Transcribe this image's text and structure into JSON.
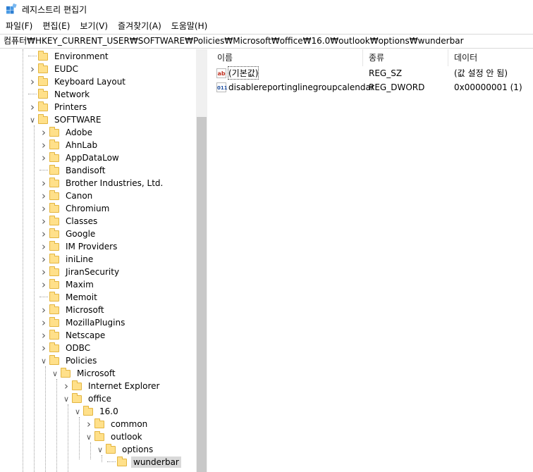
{
  "window": {
    "title": "레지스트리 편집기",
    "icon": "registry-editor-icon"
  },
  "menu": [
    "파일(F)",
    "편집(E)",
    "보기(V)",
    "즐겨찾기(A)",
    "도움말(H)"
  ],
  "address": "컴퓨터₩HKEY_CURRENT_USER₩SOFTWARE₩Policies₩Microsoft₩office₩16.0₩outlook₩options₩wunderbar",
  "tree": [
    {
      "label": "Environment",
      "level": 0,
      "expander": "none"
    },
    {
      "label": "EUDC",
      "level": 0,
      "expander": "collapsed"
    },
    {
      "label": "Keyboard Layout",
      "level": 0,
      "expander": "collapsed"
    },
    {
      "label": "Network",
      "level": 0,
      "expander": "none"
    },
    {
      "label": "Printers",
      "level": 0,
      "expander": "collapsed"
    },
    {
      "label": "SOFTWARE",
      "level": 0,
      "expander": "expanded"
    },
    {
      "label": "Adobe",
      "level": 1,
      "expander": "collapsed"
    },
    {
      "label": "AhnLab",
      "level": 1,
      "expander": "collapsed"
    },
    {
      "label": "AppDataLow",
      "level": 1,
      "expander": "collapsed"
    },
    {
      "label": "Bandisoft",
      "level": 1,
      "expander": "none"
    },
    {
      "label": "Brother Industries, Ltd.",
      "level": 1,
      "expander": "collapsed"
    },
    {
      "label": "Canon",
      "level": 1,
      "expander": "collapsed"
    },
    {
      "label": "Chromium",
      "level": 1,
      "expander": "collapsed"
    },
    {
      "label": "Classes",
      "level": 1,
      "expander": "collapsed"
    },
    {
      "label": "Google",
      "level": 1,
      "expander": "collapsed"
    },
    {
      "label": "IM Providers",
      "level": 1,
      "expander": "collapsed"
    },
    {
      "label": "iniLine",
      "level": 1,
      "expander": "collapsed"
    },
    {
      "label": "JiranSecurity",
      "level": 1,
      "expander": "collapsed"
    },
    {
      "label": "Maxim",
      "level": 1,
      "expander": "collapsed"
    },
    {
      "label": "Memoit",
      "level": 1,
      "expander": "none"
    },
    {
      "label": "Microsoft",
      "level": 1,
      "expander": "collapsed"
    },
    {
      "label": "MozillaPlugins",
      "level": 1,
      "expander": "collapsed"
    },
    {
      "label": "Netscape",
      "level": 1,
      "expander": "collapsed"
    },
    {
      "label": "ODBC",
      "level": 1,
      "expander": "collapsed"
    },
    {
      "label": "Policies",
      "level": 1,
      "expander": "expanded"
    },
    {
      "label": "Microsoft",
      "level": 2,
      "expander": "expanded"
    },
    {
      "label": "Internet Explorer",
      "level": 3,
      "expander": "collapsed"
    },
    {
      "label": "office",
      "level": 3,
      "expander": "expanded"
    },
    {
      "label": "16.0",
      "level": 4,
      "expander": "expanded"
    },
    {
      "label": "common",
      "level": 5,
      "expander": "collapsed"
    },
    {
      "label": "outlook",
      "level": 5,
      "expander": "expanded"
    },
    {
      "label": "options",
      "level": 6,
      "expander": "expanded"
    },
    {
      "label": "wunderbar",
      "level": 7,
      "expander": "none",
      "selected": true
    }
  ],
  "list": {
    "columns": [
      "이름",
      "종류",
      "데이터"
    ],
    "rows": [
      {
        "icon": "ab",
        "kind": "string-value-icon",
        "name": "(기본값)",
        "type": "REG_SZ",
        "data": "(값 설정 안 됨)",
        "focused": true
      },
      {
        "icon": "011",
        "kind": "dword-value-icon",
        "name": "disablereportinglinegroupcalendar",
        "type": "REG_DWORD",
        "data": "0x00000001 (1)"
      }
    ]
  }
}
